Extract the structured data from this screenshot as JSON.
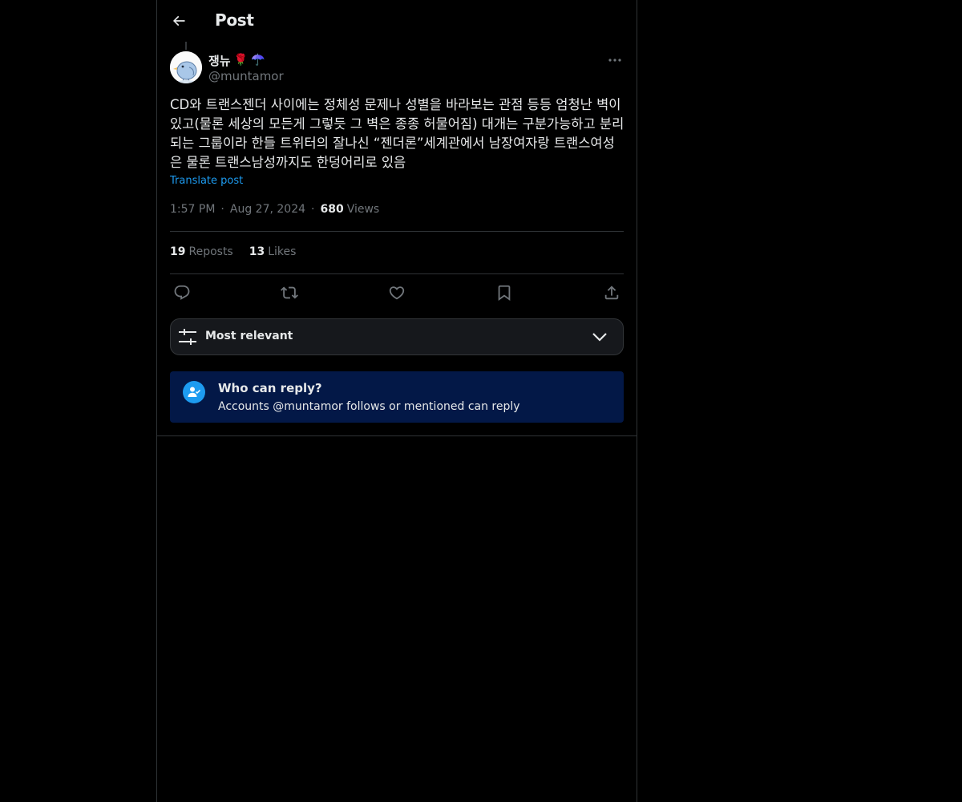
{
  "header": {
    "title": "Post"
  },
  "author": {
    "display_name": "쟁뉴",
    "emoji_1": "🌹",
    "emoji_2": "☂️",
    "handle": "@muntamor"
  },
  "tweet": {
    "text": "CD와 트랜스젠더 사이에는 정체성 문제나 성별을 바라보는 관점 등등 엄청난 벽이\n있고(물론 세상의 모든게 그렇듯 그 벽은 종종 허물어짐) 대개는 구분가능하고 분리\n되는 그룹이라 한들 트위터의 잘나신 “젠더론”세계관에서 남장여자랑 트랜스여성\n은 물론 트랜스남성까지도 한덩어리로 있음",
    "translate": "Translate post",
    "time": "1:57 PM",
    "date": "Aug 27, 2024",
    "views_count": "680",
    "views_label": "Views"
  },
  "stats": {
    "reposts_count": "19",
    "reposts_label": "Reposts",
    "likes_count": "13",
    "likes_label": "Likes"
  },
  "sort": {
    "label": "Most relevant"
  },
  "reply_restriction": {
    "title": "Who can reply?",
    "subtitle": "Accounts @muntamor follows or mentioned can reply"
  },
  "colors": {
    "accent": "#1d9bf0",
    "reply_box_bg": "#031847",
    "muted_text": "#71767b"
  },
  "icons": [
    "back-arrow-icon",
    "more-icon",
    "reply-icon",
    "repost-icon",
    "like-icon",
    "bookmark-icon",
    "share-icon",
    "sliders-icon",
    "chevron-down-icon",
    "person-check-icon"
  ]
}
